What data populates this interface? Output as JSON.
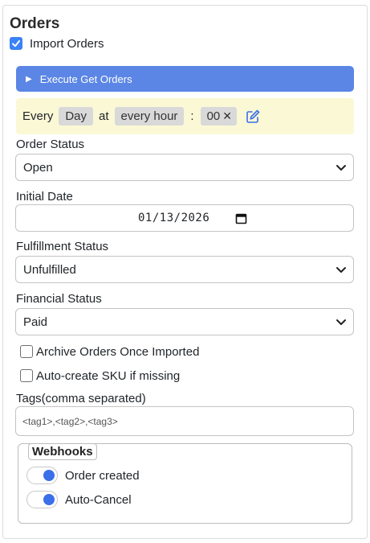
{
  "orders": {
    "title": "Orders",
    "import_orders": {
      "label": "Import Orders",
      "checked": true
    },
    "execute_button": {
      "label": "Execute Get Orders"
    },
    "schedule": {
      "every": "Every",
      "frequency": "Day",
      "at": "at",
      "hour": "every hour",
      "colon": ":",
      "minute": "00",
      "clear_symbol": "✕",
      "edit_icon": "pencil-square-icon"
    },
    "order_status": {
      "label": "Order Status",
      "value": "Open"
    },
    "initial_date": {
      "label": "Initial Date",
      "value": "01/13/2026"
    },
    "fulfillment_status": {
      "label": "Fulfillment Status",
      "value": "Unfulfilled"
    },
    "financial_status": {
      "label": "Financial Status",
      "value": "Paid"
    },
    "archive_orders": {
      "label": "Archive Orders Once Imported",
      "checked": false
    },
    "auto_create_sku": {
      "label": "Auto-create SKU if missing",
      "checked": false
    },
    "tags": {
      "label": "Tags(comma separated)",
      "value": "<tag1>,<tag2>,<tag3>"
    },
    "webhooks": {
      "legend": "Webhooks",
      "order_created": {
        "label": "Order created",
        "enabled": true
      },
      "auto_cancel": {
        "label": "Auto-Cancel",
        "enabled": true
      }
    }
  },
  "colors": {
    "accent": "#3b82f6",
    "button": "#5b86e5",
    "schedule_bg": "#fbf8d6",
    "chip_bg": "#d9d9d9"
  }
}
